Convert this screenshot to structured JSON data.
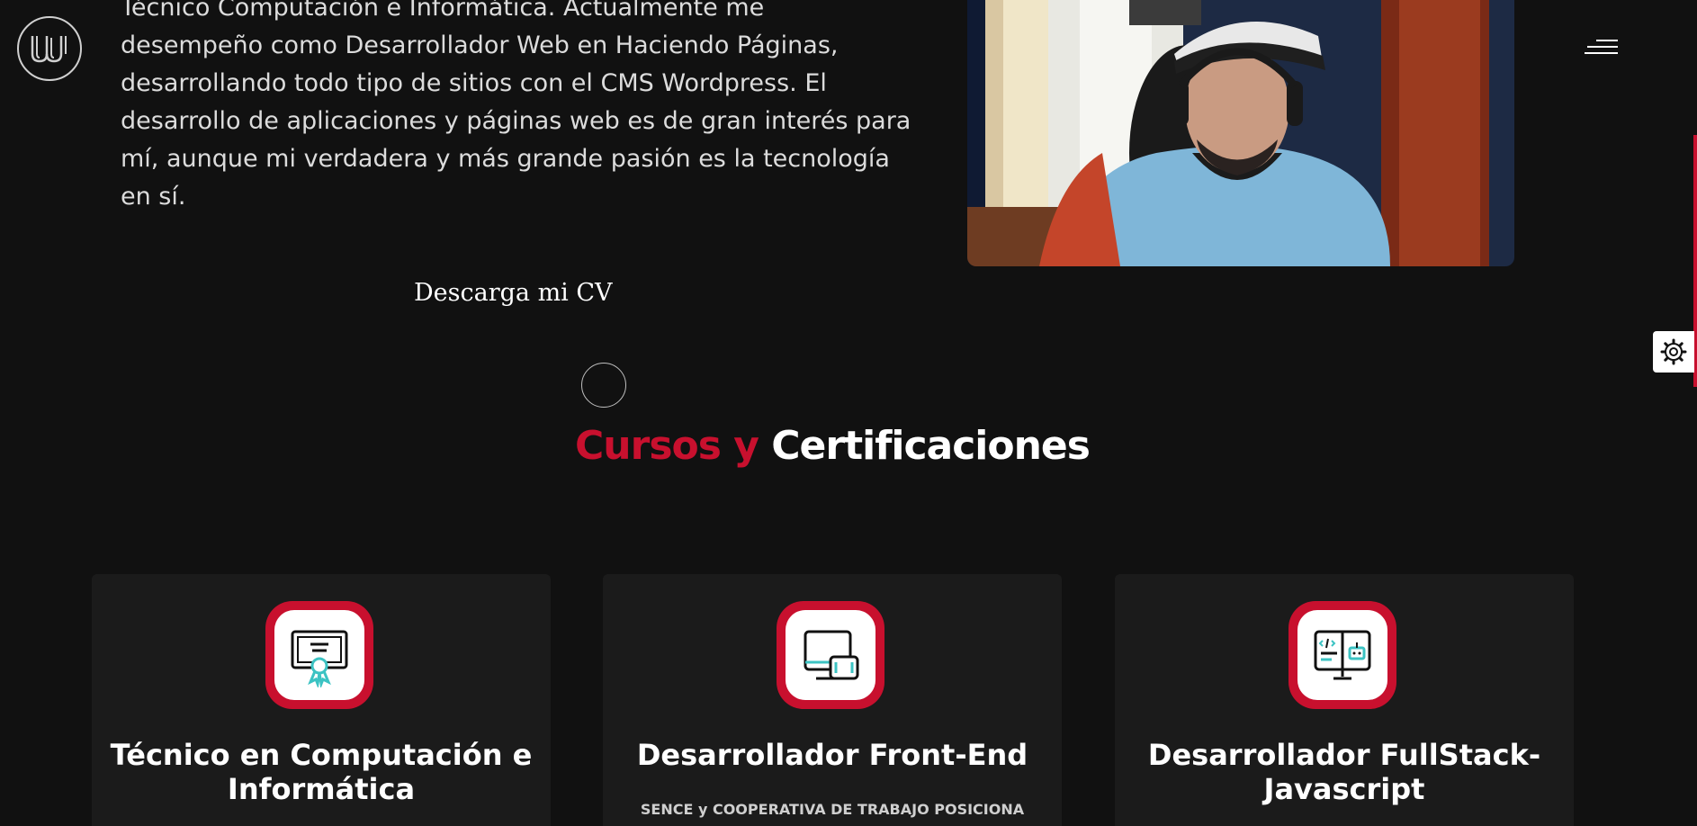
{
  "about": {
    "paragraph": "Técnico Computación e Informática. Actualmente me desempeño como Desarrollador Web en Haciendo Páginas, desarrollando todo tipo de sitios con el CMS Wordpress. El desarrollo de aplicaciones y páginas web es de gran interés para mí, aunque mi verdadera y más grande pasión es la tecnología en sí.",
    "cv_link": "Descarga mi CV"
  },
  "header": {
    "logo_icon": "w-monogram-logo",
    "menu_icon": "hamburger-menu-icon"
  },
  "settings": {
    "icon": "gear-icon"
  },
  "section": {
    "title_accent": "Cursos y",
    "title_rest": "Certificaciones"
  },
  "courses": [
    {
      "title": "Técnico en Computación e Informática",
      "subtitle": "",
      "icon": "certificate-icon"
    },
    {
      "title": "Desarrollador Front-End",
      "subtitle": "SENCE y COOPERATIVA DE TRABAJO POSICIONA",
      "icon": "devices-icon"
    },
    {
      "title": "Desarrollador FullStack-Javascript",
      "subtitle": "",
      "icon": "code-monitor-icon"
    }
  ],
  "colors": {
    "background": "#111111",
    "card": "#1b1b1b",
    "accent": "#c8102e",
    "icon_teal": "#3cc3c3"
  }
}
